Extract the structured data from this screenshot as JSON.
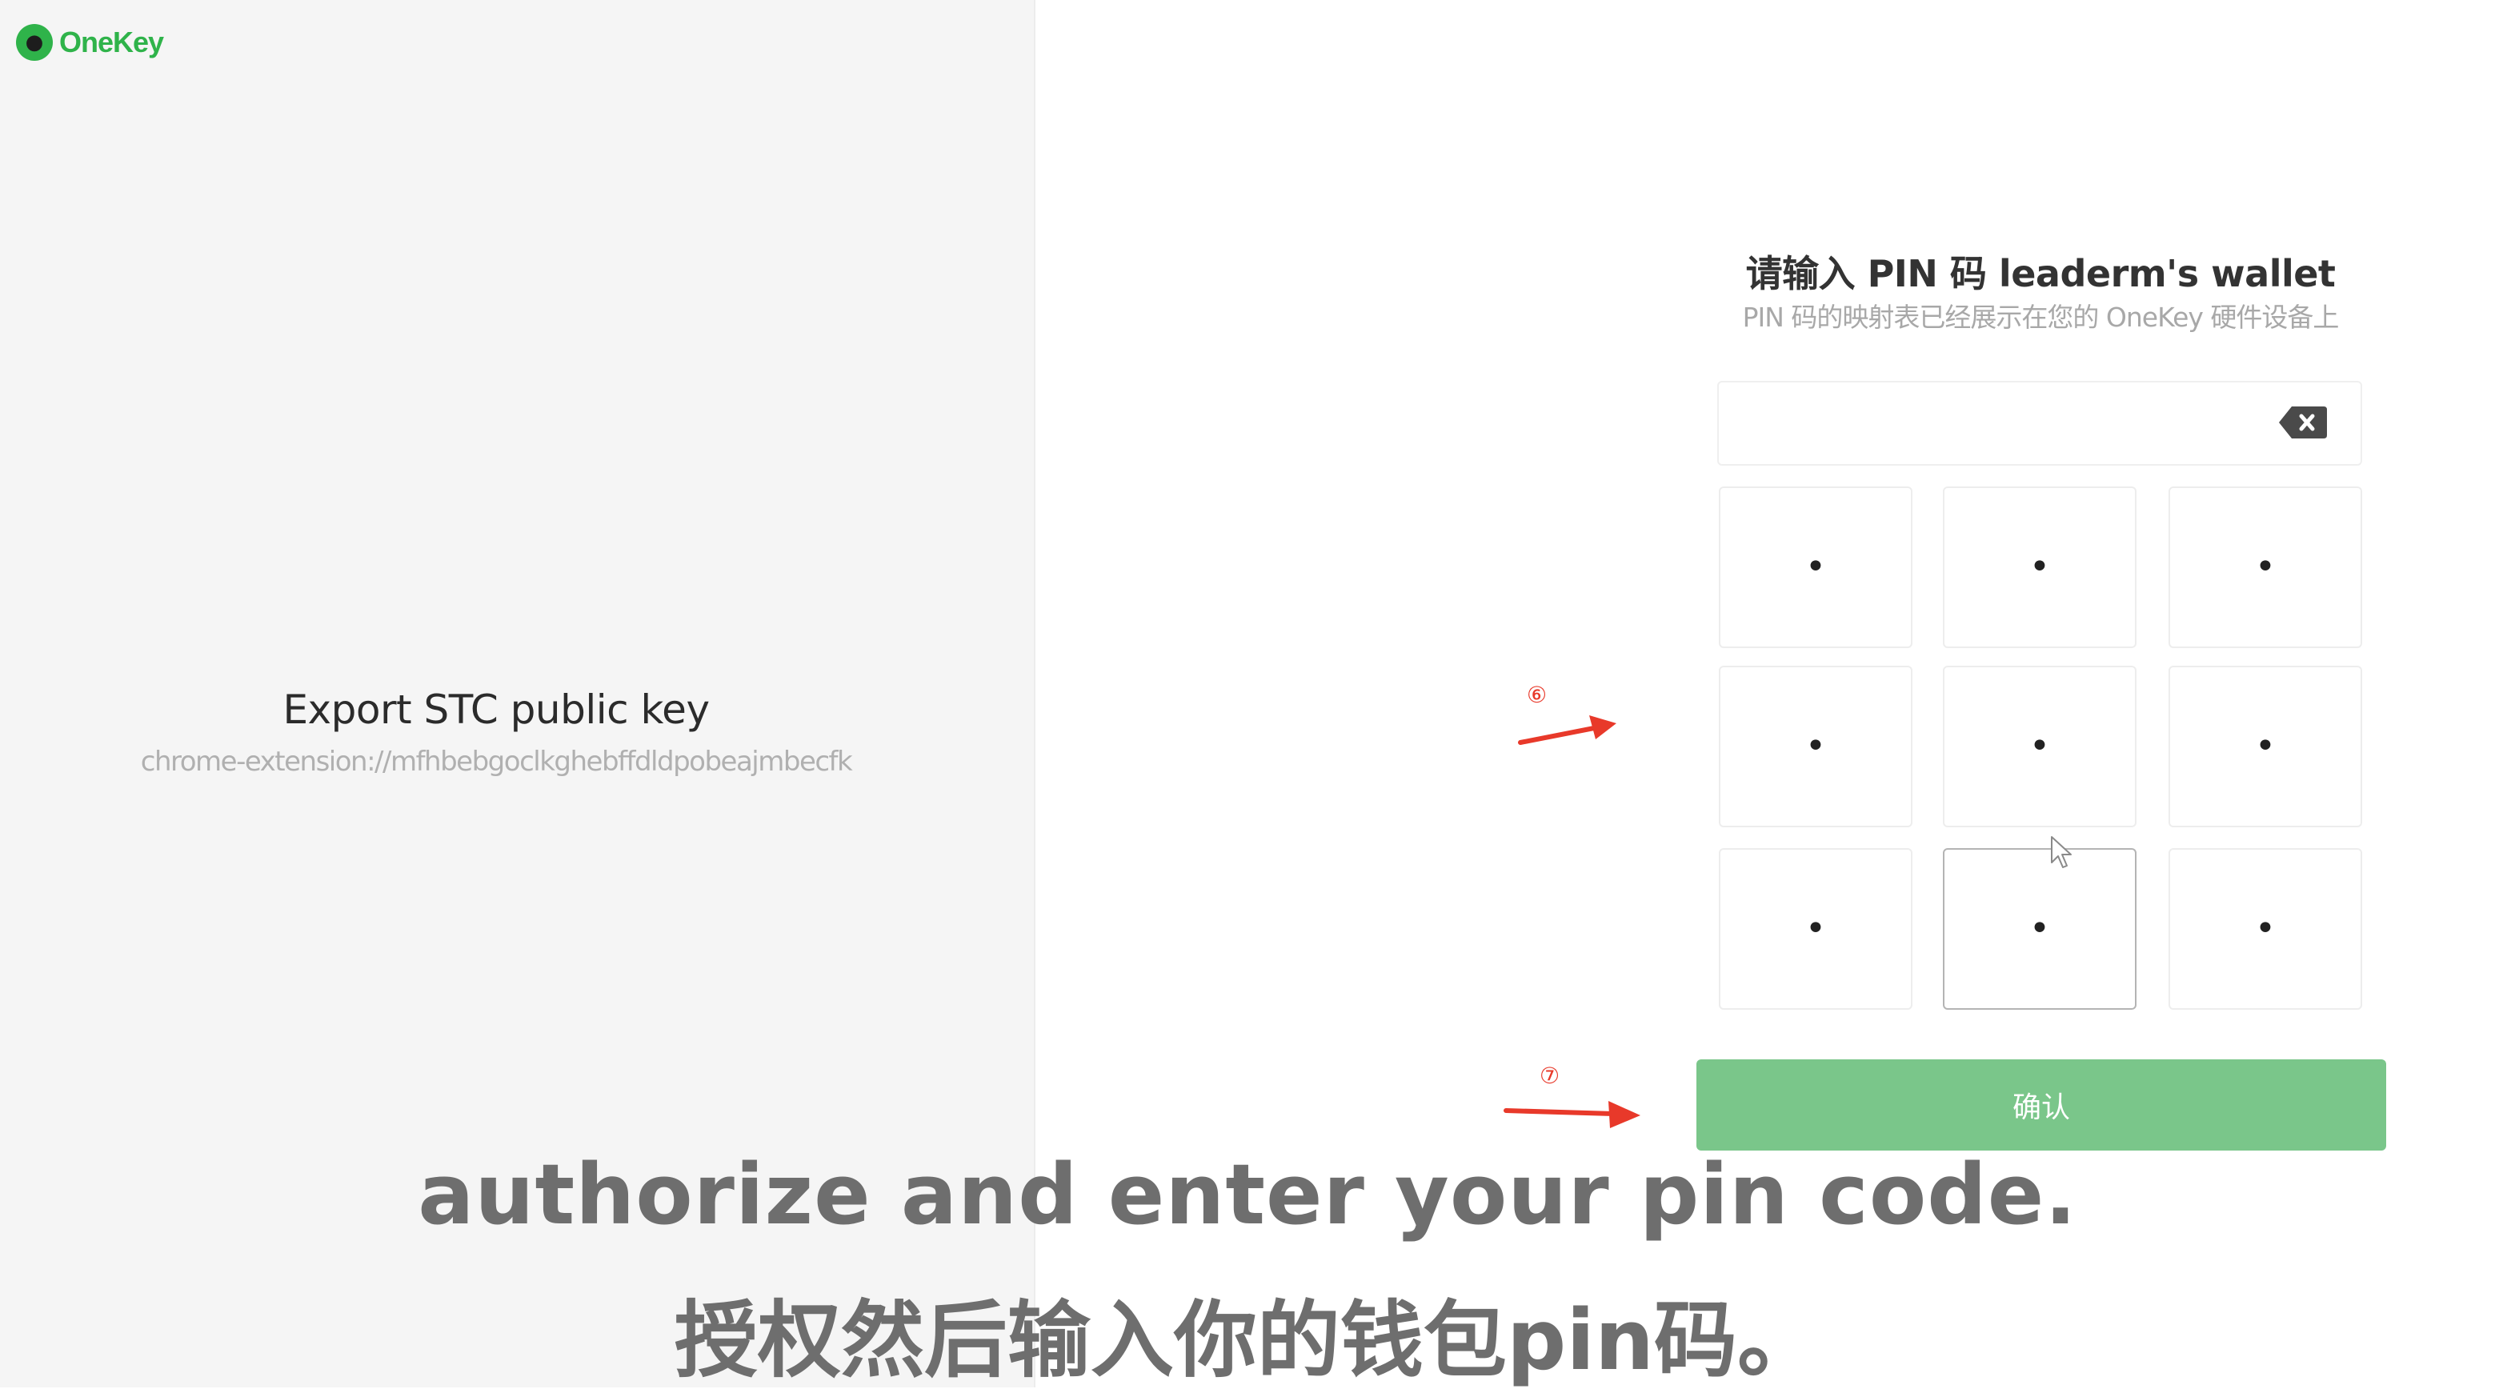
{
  "brand": {
    "name": "OneKey",
    "color": "#2fb34a"
  },
  "export": {
    "title": "Export STC public key",
    "url": "chrome-extension://mfhbebgoclkghebffdldpobeajmbecfk"
  },
  "pin": {
    "title": "请输入 PIN 码 leaderm's wallet",
    "subtitle": "PIN 码的映射表已经展示在您的 OneKey 硬件设备上",
    "input_value": "",
    "keys": [
      "•",
      "•",
      "•",
      "•",
      "•",
      "•",
      "•",
      "•",
      "•"
    ],
    "confirm_label": "确认",
    "confirm_color": "#7ac68a"
  },
  "annotations": {
    "step_6": "⑥",
    "step_7": "⑦",
    "arrow_color": "#e8392a"
  },
  "captions": {
    "english": "authorize and enter your pin code.",
    "chinese": "授权然后输入你的钱包pin码。"
  },
  "icons": {
    "logo": "onekey-logo-icon",
    "backspace": "backspace-icon",
    "cursor": "mouse-pointer-icon"
  }
}
